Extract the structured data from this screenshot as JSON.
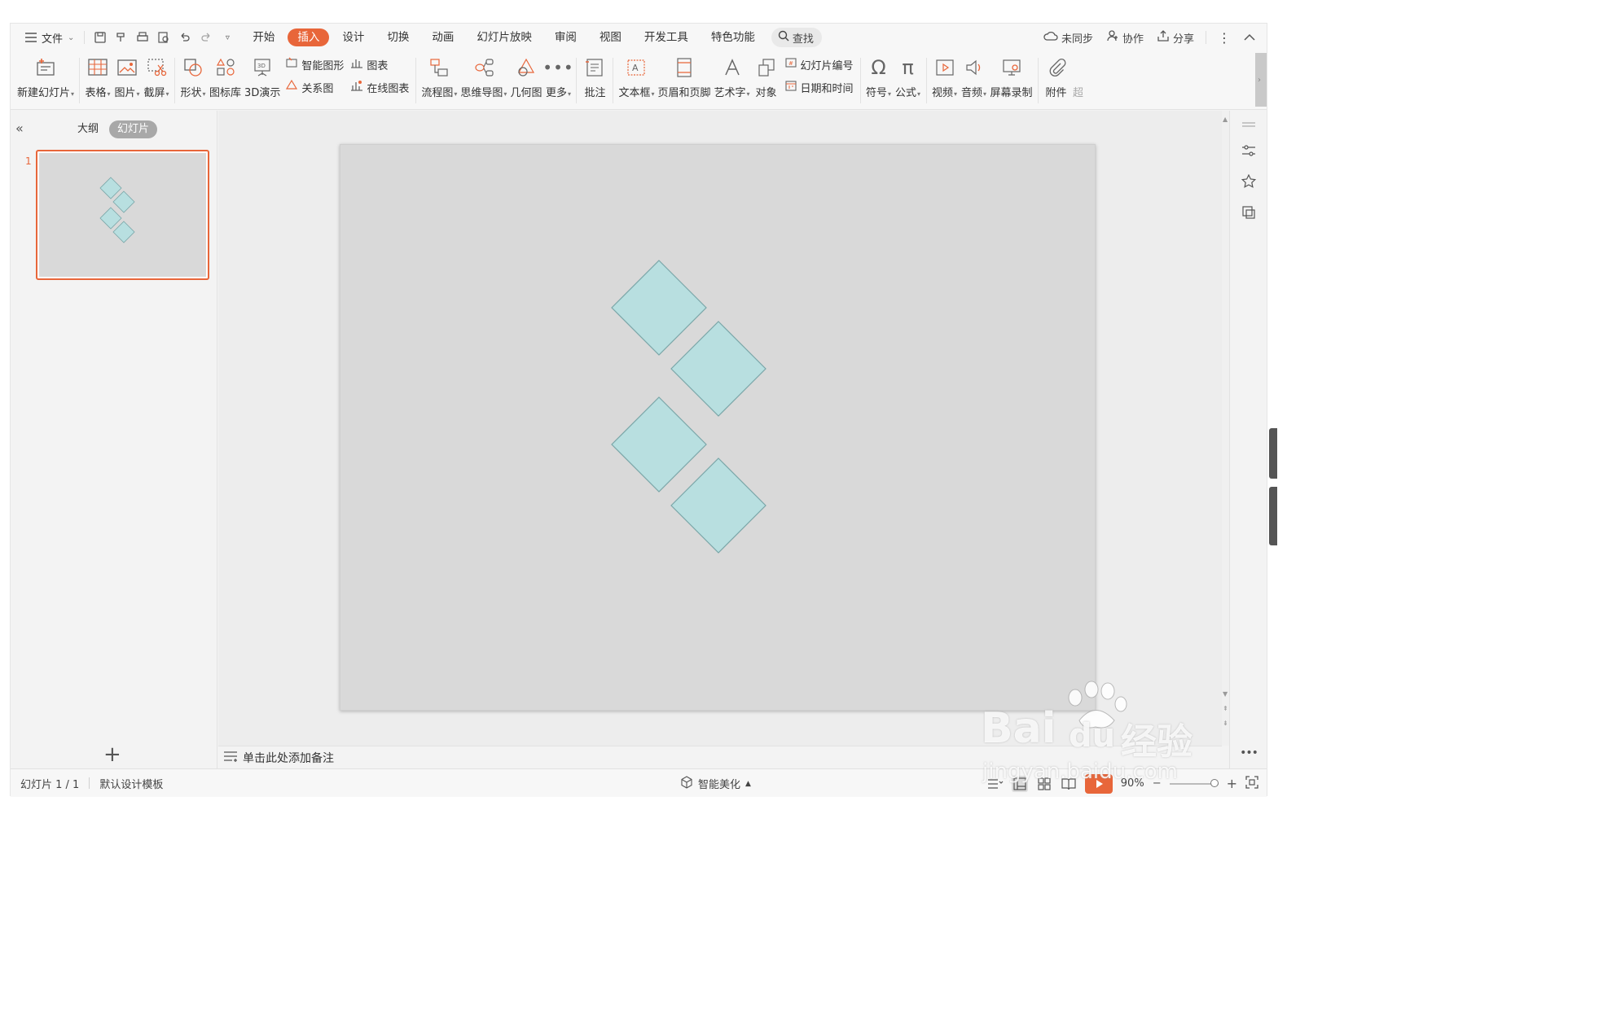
{
  "menubar": {
    "file_label": "文件",
    "tabs": [
      "开始",
      "插入",
      "设计",
      "切换",
      "动画",
      "幻灯片放映",
      "审阅",
      "视图",
      "开发工具",
      "特色功能"
    ],
    "active_tab": "插入",
    "search_label": "查找",
    "sync_label": "未同步",
    "collab_label": "协作",
    "share_label": "分享"
  },
  "ribbon": {
    "new_slide": "新建幻灯片",
    "table": "表格",
    "picture": "图片",
    "screenshot": "截屏",
    "shapes": "形状",
    "icon_lib": "图标库",
    "demo3d": "3D演示",
    "smartart": "智能图形",
    "chart": "图表",
    "relation": "关系图",
    "online_chart": "在线图表",
    "flowchart": "流程图",
    "mindmap": "思维导图",
    "geometry": "几何图",
    "more": "更多",
    "comment": "批注",
    "textbox": "文本框",
    "header_footer": "页眉和页脚",
    "wordart": "艺术字",
    "object": "对象",
    "slide_number": "幻灯片编号",
    "datetime": "日期和时间",
    "symbol": "符号",
    "formula": "公式",
    "video": "视频",
    "audio": "音频",
    "screen_record": "屏幕录制",
    "attachment": "附件",
    "overflow": "超"
  },
  "leftpanel": {
    "outline_tab": "大纲",
    "slides_tab": "幻灯片",
    "slide_number": "1"
  },
  "notes": {
    "placeholder": "单击此处添加备注"
  },
  "statusbar": {
    "slide_info": "幻灯片 1 / 1",
    "template": "默认设计模板",
    "beautify": "智能美化",
    "zoom": "90%"
  },
  "slide": {
    "background": "#d9d9d9",
    "shape_fill": "#b8dfe0",
    "shape_stroke": "#7aa6a8",
    "shapes": [
      "diamond",
      "diamond",
      "diamond",
      "diamond"
    ]
  },
  "watermark": {
    "brand": "Bai",
    "brand2": "du",
    "cn": "经验",
    "url": "jingyan.baidu.com"
  },
  "colors": {
    "accent": "#e8663a"
  }
}
